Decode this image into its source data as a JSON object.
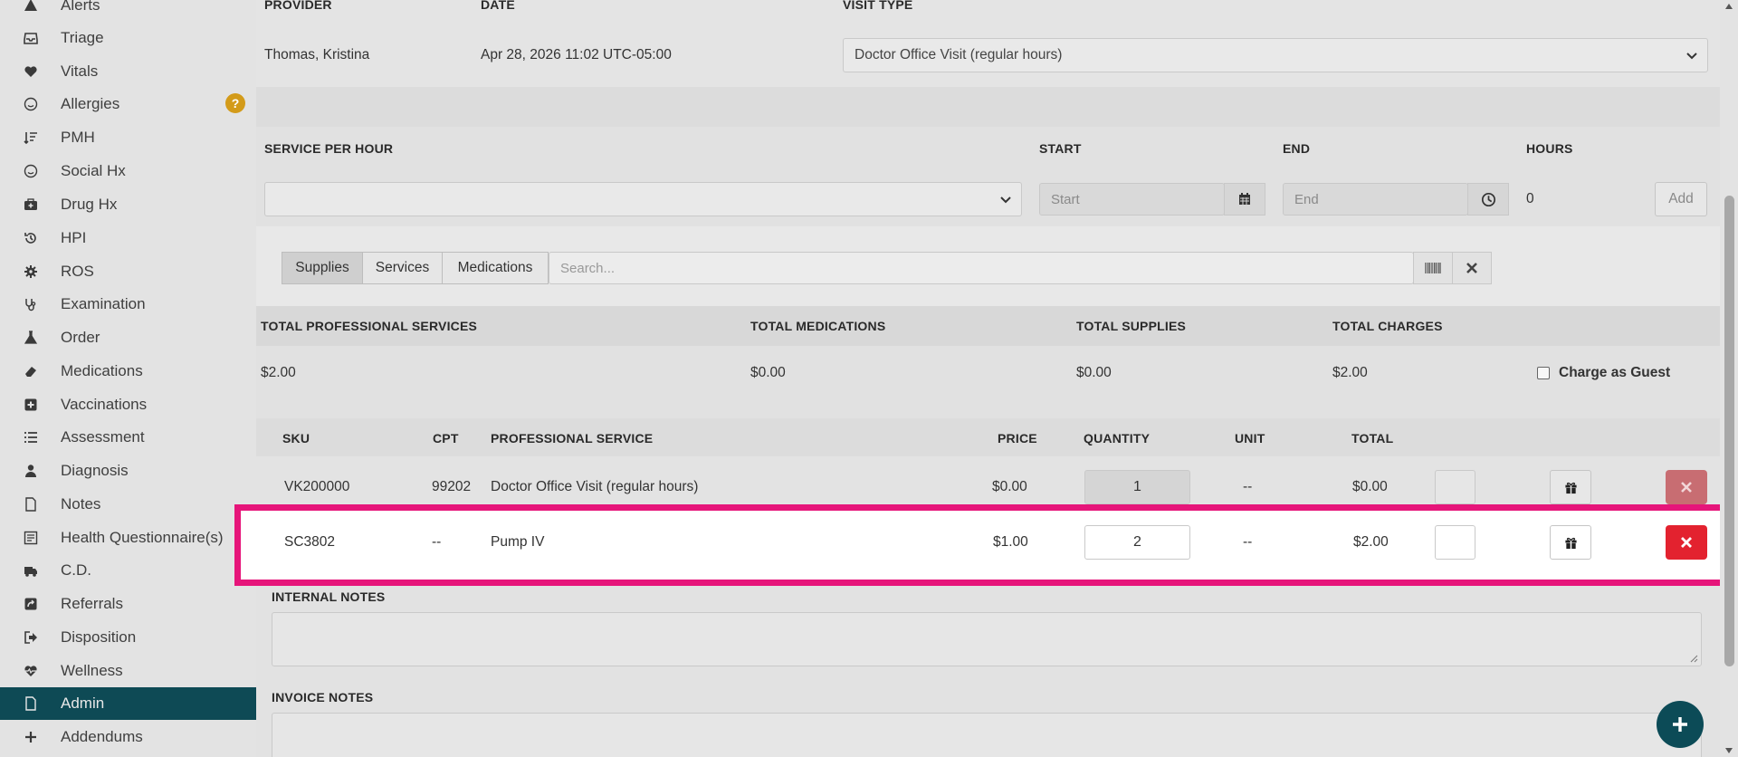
{
  "sidebar": {
    "items": [
      {
        "label": "Alerts",
        "icon": "warning-icon"
      },
      {
        "label": "Triage",
        "icon": "inbox-icon"
      },
      {
        "label": "Vitals",
        "icon": "heart-icon"
      },
      {
        "label": "Allergies",
        "icon": "smiley-icon"
      },
      {
        "label": "PMH",
        "icon": "sort-list-icon"
      },
      {
        "label": "Social Hx",
        "icon": "smiley-icon"
      },
      {
        "label": "Drug Hx",
        "icon": "medkit-icon"
      },
      {
        "label": "HPI",
        "icon": "history-icon"
      },
      {
        "label": "ROS",
        "icon": "gear-icon"
      },
      {
        "label": "Examination",
        "icon": "stethoscope-icon"
      },
      {
        "label": "Order",
        "icon": "flask-icon"
      },
      {
        "label": "Medications",
        "icon": "eraser-icon"
      },
      {
        "label": "Vaccinations",
        "icon": "plus-square-icon"
      },
      {
        "label": "Assessment",
        "icon": "list-icon"
      },
      {
        "label": "Diagnosis",
        "icon": "user-md-icon"
      },
      {
        "label": "Notes",
        "icon": "file-icon"
      },
      {
        "label": "Health Questionnaire(s)",
        "icon": "form-icon"
      },
      {
        "label": "C.D.",
        "icon": "ambulance-icon"
      },
      {
        "label": "Referrals",
        "icon": "share-square-icon"
      },
      {
        "label": "Disposition",
        "icon": "sign-out-icon"
      },
      {
        "label": "Wellness",
        "icon": "heartbeat-icon"
      },
      {
        "label": "Admin",
        "icon": "file-icon"
      },
      {
        "label": "Addendums",
        "icon": "plus-icon"
      }
    ],
    "help_badge": "?"
  },
  "visit": {
    "provider_header": "PROVIDER",
    "date_header": "DATE",
    "visit_type_header": "VISIT TYPE",
    "provider": "Thomas, Kristina",
    "date": "Apr 28, 2026 11:02 UTC-05:00",
    "visit_type": "Doctor Office Visit (regular hours)"
  },
  "service_per_hour": {
    "header": "SERVICE PER HOUR",
    "start_header": "START",
    "end_header": "END",
    "hours_header": "HOURS",
    "start_placeholder": "Start",
    "end_placeholder": "End",
    "hours": "0",
    "add_label": "Add"
  },
  "tabs": {
    "supplies": "Supplies",
    "services": "Services",
    "medications": "Medications",
    "search_placeholder": "Search..."
  },
  "totals": {
    "prof_header": "TOTAL PROFESSIONAL SERVICES",
    "med_header": "TOTAL MEDICATIONS",
    "sup_header": "TOTAL SUPPLIES",
    "charges_header": "TOTAL CHARGES",
    "prof": "$2.00",
    "med": "$0.00",
    "sup": "$0.00",
    "charges": "$2.00",
    "guest_label": "Charge as Guest"
  },
  "table": {
    "headers": {
      "sku": "SKU",
      "cpt": "CPT",
      "service": "PROFESSIONAL SERVICE",
      "price": "PRICE",
      "quantity": "QUANTITY",
      "unit": "UNIT",
      "total": "TOTAL"
    },
    "rows": [
      {
        "sku": "VK200000",
        "cpt": "99202",
        "service": "Doctor Office Visit (regular hours)",
        "price": "$0.00",
        "quantity": "1",
        "unit": "--",
        "total": "$0.00"
      },
      {
        "sku": "SC3802",
        "cpt": "--",
        "service": "Pump IV",
        "price": "$1.00",
        "quantity": "2",
        "unit": "--",
        "total": "$2.00"
      }
    ]
  },
  "notes": {
    "internal_header": "INTERNAL NOTES",
    "invoice_header": "INVOICE NOTES"
  },
  "colors": {
    "accent": "#0e4a55",
    "danger": "#e3222f",
    "highlight": "#e6157a",
    "help": "#d39b1a"
  }
}
